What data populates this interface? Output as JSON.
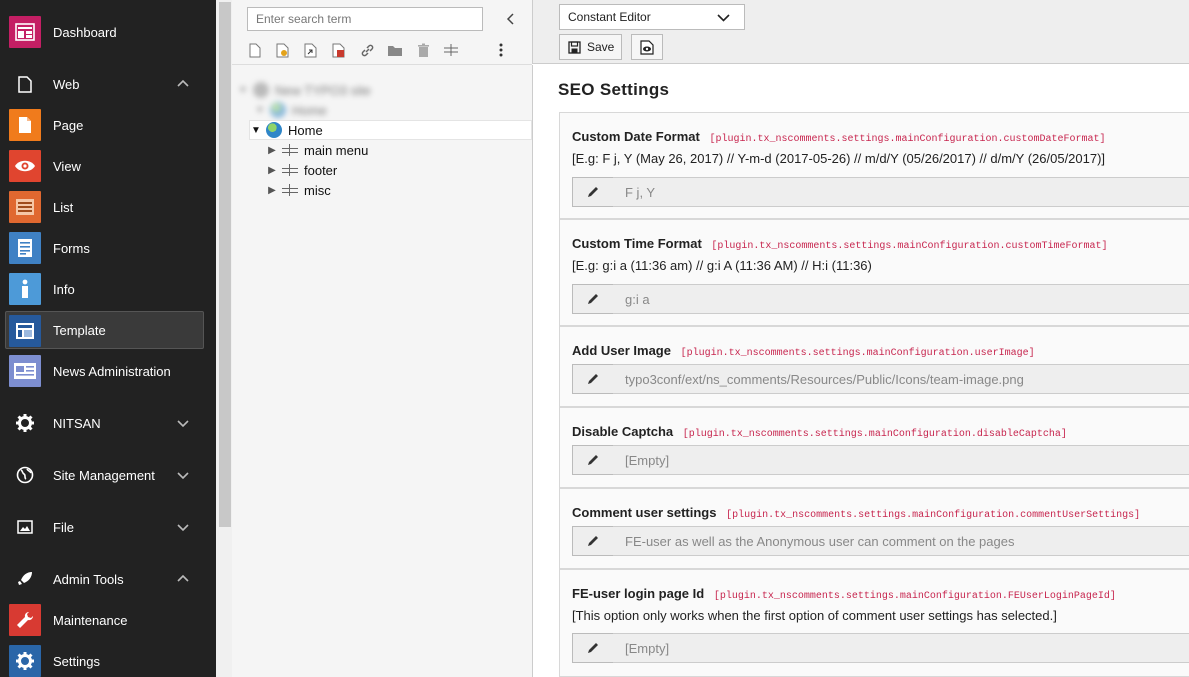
{
  "module_menu": {
    "items": [
      {
        "label": "Dashboard",
        "icon": "dashboard-icon",
        "color": "#c41f64",
        "type": "module"
      },
      {
        "label": "Web",
        "icon": "file-icon",
        "type": "group",
        "expanded": true
      },
      {
        "label": "Page",
        "icon": "page-icon",
        "color": "#f07b1c",
        "type": "module"
      },
      {
        "label": "View",
        "icon": "eye-icon",
        "color": "#e0452f",
        "type": "module"
      },
      {
        "label": "List",
        "icon": "list-icon",
        "color": "#e06830",
        "type": "module"
      },
      {
        "label": "Forms",
        "icon": "forms-icon",
        "color": "#3f81c4",
        "type": "module"
      },
      {
        "label": "Info",
        "icon": "info-icon",
        "color": "#4d9ad8",
        "type": "module"
      },
      {
        "label": "Template",
        "icon": "template-icon",
        "color": "#26599b",
        "type": "module",
        "active": true
      },
      {
        "label": "News Administration",
        "icon": "news-icon",
        "color": "#7d8ed0",
        "type": "module"
      },
      {
        "label": "NITSAN",
        "icon": "gear-icon",
        "type": "group",
        "expanded": false
      },
      {
        "label": "Site Management",
        "icon": "globe-icon",
        "type": "group",
        "expanded": false
      },
      {
        "label": "File",
        "icon": "image-icon",
        "type": "group",
        "expanded": false
      },
      {
        "label": "Admin Tools",
        "icon": "rocket-icon",
        "type": "group",
        "expanded": true
      },
      {
        "label": "Maintenance",
        "icon": "wrench-icon",
        "color": "#d83a32",
        "type": "module"
      },
      {
        "label": "Settings",
        "icon": "gear-icon",
        "color": "#2a66a8",
        "type": "module"
      }
    ]
  },
  "page_tree": {
    "search": {
      "placeholder": "Enter search term"
    },
    "toolbar": [
      "new-page-icon",
      "new-folder-page-icon",
      "new-link-page-icon",
      "new-shortcut-icon",
      "link-icon",
      "folder-icon",
      "trash-icon",
      "spacer-icon",
      "more-icon"
    ],
    "blurred_root": "New TYPO3 site",
    "blurred_child": "Home",
    "nodes": [
      {
        "label": "Home",
        "type": "root",
        "expanded": true
      },
      {
        "label": "main menu",
        "type": "spacer"
      },
      {
        "label": "footer",
        "type": "spacer"
      },
      {
        "label": "misc",
        "type": "spacer"
      }
    ]
  },
  "docheader": {
    "editor_select": "Constant Editor",
    "save_label": "Save"
  },
  "content": {
    "section_title": "SEO Settings",
    "constants": [
      {
        "name": "Custom Date Format",
        "key": "[plugin.tx_nscomments.settings.mainConfiguration.customDateFormat]",
        "description": "[E.g: F j, Y (May 26, 2017) // Y-m-d (2017-05-26) // m/d/Y (05/26/2017) // d/m/Y (26/05/2017)]",
        "value": "F j, Y"
      },
      {
        "name": "Custom Time Format",
        "key": "[plugin.tx_nscomments.settings.mainConfiguration.customTimeFormat]",
        "description": "[E.g: g:i a (11:36 am) // g:i A (11:36 AM) // H:i (11:36)",
        "value": "g:i a"
      },
      {
        "name": "Add User Image",
        "key": "[plugin.tx_nscomments.settings.mainConfiguration.userImage]",
        "description": "",
        "value": "typo3conf/ext/ns_comments/Resources/Public/Icons/team-image.png"
      },
      {
        "name": "Disable Captcha",
        "key": "[plugin.tx_nscomments.settings.mainConfiguration.disableCaptcha]",
        "description": "",
        "value": "[Empty]"
      },
      {
        "name": "Comment user settings",
        "key": "[plugin.tx_nscomments.settings.mainConfiguration.commentUserSettings]",
        "description": "",
        "value": "FE-user as well as the Anonymous user can comment on the pages"
      },
      {
        "name": "FE-user login page Id",
        "key": "[plugin.tx_nscomments.settings.mainConfiguration.FEUserLoginPageId]",
        "description": "[This option only works when the first option of comment user settings has selected.]",
        "value": "[Empty]"
      }
    ]
  }
}
